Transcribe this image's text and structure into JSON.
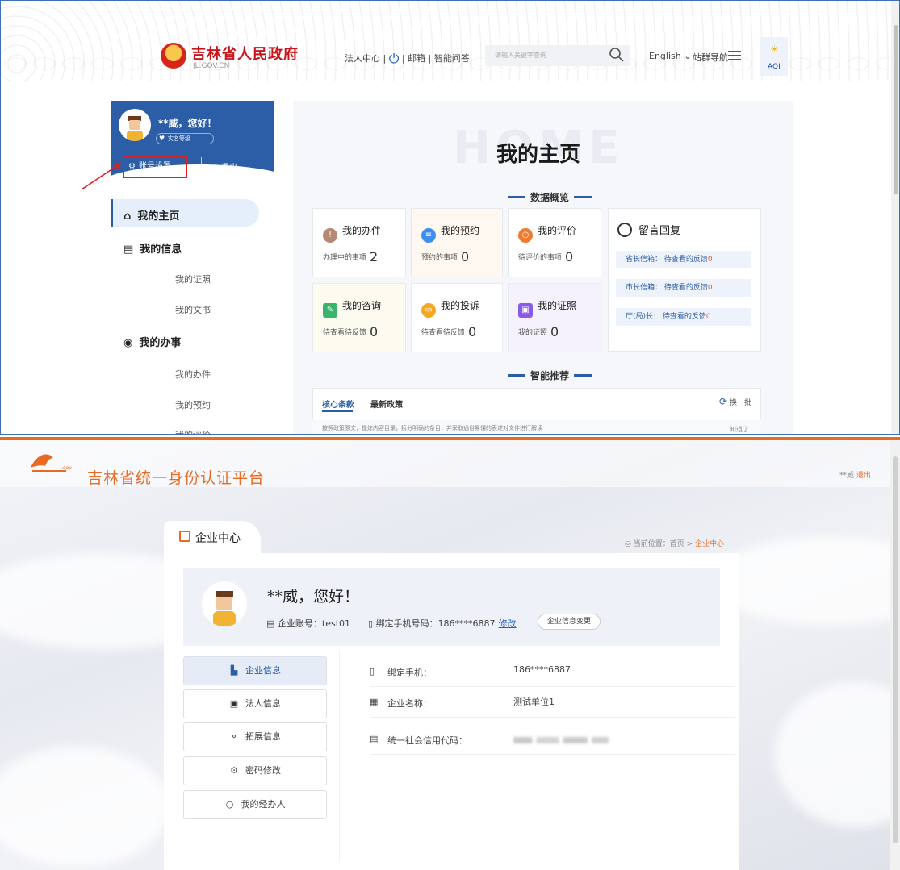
{
  "top": {
    "gov_name": "吉林省人民政府",
    "gov_domain": "JL.GOV.CN",
    "links": [
      "法人中心",
      "邮箱",
      "智能问答"
    ],
    "search_placeholder": "请输入关键字查询",
    "language": "English",
    "site_nav": "站群导航",
    "aqi": "AQI",
    "greeting": "**威，您好！",
    "realname": "实名等级",
    "account_settings": "账号设置",
    "logout": "退出",
    "nav": {
      "home": "我的主页",
      "info": "我的信息",
      "info_children": [
        "我的证照",
        "我的文书"
      ],
      "affairs": "我的办事",
      "affairs_children": [
        "我的办件",
        "我的预约",
        "我的评价"
      ]
    },
    "home_watermark": "HOME",
    "home_title": "我的主页",
    "data_overview": "数据概览",
    "cards": [
      {
        "title": "我的办件",
        "sub": "办理中的事项",
        "num": "2",
        "color": "#b48a74"
      },
      {
        "title": "我的预约",
        "sub": "预约的事项",
        "num": "0",
        "color": "#3e8ef0"
      },
      {
        "title": "我的评价",
        "sub": "待评价的事项",
        "num": "0",
        "color": "#f07a2e"
      },
      {
        "title": "我的咨询",
        "sub": "待查看待反馈",
        "num": "0",
        "color": "#38b56a"
      },
      {
        "title": "我的投诉",
        "sub": "待查看待反馈",
        "num": "0",
        "color": "#f5a623"
      },
      {
        "title": "我的证照",
        "sub": "我的证照",
        "num": "0",
        "color": "#8a5ce6"
      }
    ],
    "messages": {
      "title": "留言回复",
      "rows": [
        {
          "label": "省长信箱：",
          "text": "待查看的反馈",
          "count": "0"
        },
        {
          "label": "市长信箱：",
          "text": "待查看的反馈",
          "count": "0"
        },
        {
          "label": "厅(局)长：",
          "text": "待查看的反馈",
          "count": "0"
        }
      ]
    },
    "smart_rec": "智能推荐",
    "tab_core": "核心条款",
    "tab_latest": "最新政策",
    "refresh": "换一批",
    "rec_hint": "按照政策原文，提炼内容目录，拆分明确的条目，并采取通俗易懂的表述对文件进行解读",
    "rec_know": "知道了"
  },
  "bottom": {
    "platform_title": "吉林省统一身份认证平台",
    "user": "**威",
    "logout": "退出",
    "tab_label": "企业中心",
    "breadcrumb_prefix": "当前位置：",
    "breadcrumb_home": "首页",
    "breadcrumb_sep": " > ",
    "breadcrumb_current": "企业中心",
    "greeting": "**威，您好！",
    "account_label": "企业账号：",
    "account_value": "test01",
    "phone_label": "绑定手机号码：",
    "phone_value": "186****6887",
    "modify": "修改",
    "change_btn": "企业信息变更",
    "side_items": [
      {
        "label": "企业信息",
        "icon": "building-icon",
        "glyph": "▙"
      },
      {
        "label": "法人信息",
        "icon": "id-card-icon",
        "glyph": "▣"
      },
      {
        "label": "拓展信息",
        "icon": "share-icon",
        "glyph": "⚬"
      },
      {
        "label": "密码修改",
        "icon": "lock-gear-icon",
        "glyph": "⚙"
      },
      {
        "label": "我的经办人",
        "icon": "user-cycle-icon",
        "glyph": "○"
      }
    ],
    "info_rows": [
      {
        "label": "绑定手机：",
        "value": "186****6887",
        "icon": "phone-icon",
        "glyph": "▯"
      },
      {
        "label": "企业名称：",
        "value": "测试单位1",
        "icon": "building-icon",
        "glyph": "▦"
      },
      {
        "label": "统一社会信用代码：",
        "value": "",
        "icon": "id-card-icon",
        "glyph": "▤"
      }
    ]
  }
}
